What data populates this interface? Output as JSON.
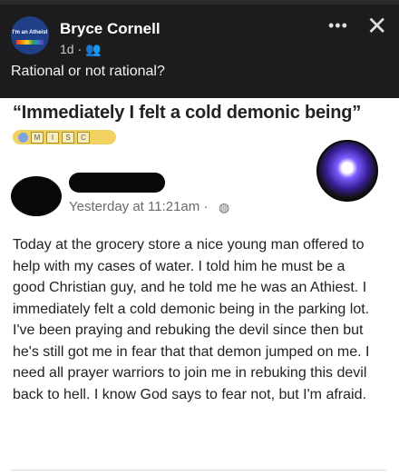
{
  "header": {
    "avatar_text": "I'm an Atheist",
    "name": "Bryce Cornell",
    "meta": "1d · 👥",
    "caption": "Rational or not rational?",
    "more_icon": "•••",
    "close_icon": "✕"
  },
  "post": {
    "headline": "“Immediately I felt a cold demonic being”",
    "misc_labels": [
      "M",
      "I",
      "S",
      "C"
    ],
    "timestamp": "Yesterday at 11:21am ·",
    "body": "Today at the grocery store a nice young man offered to help with my cases of water. I told him he must be a good Christian guy, and he told me he was an Athiest. I immediately felt a cold demonic being in the parking lot. I've been praying and rebuking the devil since then but he's still got me in fear that that demon jumped on me. I need all prayer warriors to join me in rebuking this devil back to hell. I know God says to fear not, but I'm afraid."
  }
}
